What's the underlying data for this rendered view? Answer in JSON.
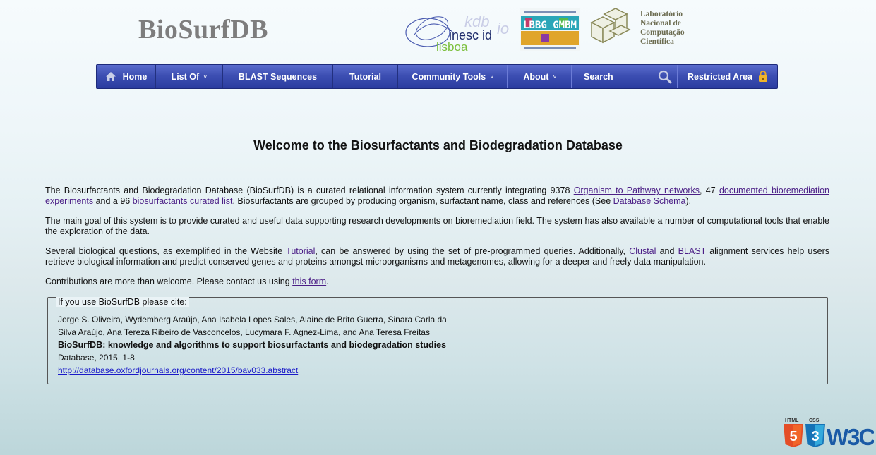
{
  "header": {
    "site_title": "BioSurfDB",
    "partners": {
      "inesc": {
        "line1": "kdb",
        "line2": "inesc id",
        "line3": "lisboa",
        "bio": "io"
      },
      "bbg": {
        "text": "LBBG GMBM"
      },
      "lncc": {
        "lines": [
          "Laboratório",
          "Nacional de",
          "Computação",
          "Científica"
        ]
      }
    }
  },
  "nav": {
    "home": "Home",
    "list_of": "List Of",
    "blast": "BLAST Sequences",
    "tutorial": "Tutorial",
    "community_tools": "Community Tools",
    "about": "About",
    "search": "Search",
    "restricted": "Restricted Area",
    "chevron": "˅"
  },
  "main": {
    "title": "Welcome to the Biosurfactants and Biodegradation Database",
    "p1": {
      "text1": "The Biosurfactants and Biodegradation Database (BioSurfDB) is a curated relational information system currently integrating 9378 ",
      "link1": "Organism to Pathway networks",
      "text2": ", 47 ",
      "link2": "documented bioremediation experiments",
      "text3": " and a 96 ",
      "link3": "biosurfactants curated list",
      "text4": ". Biosurfactants are grouped by producing organism, surfactant name, class and references (See ",
      "link4": "Database Schema",
      "text5": ")."
    },
    "p2": "The main goal of this system is to provide curated and useful data supporting research developments on bioremediation field. The system has also available a number of computational tools that enable the exploration of the data.",
    "p3": {
      "text1": "Several biological questions, as exemplified in the Website ",
      "link1": "Tutorial",
      "text2": ", can be answered by using the set of pre-programmed queries. Additionally, ",
      "link2": "Clustal",
      "text3": " and ",
      "link3": "BLAST",
      "text4": " alignment services help users retrieve biological information and predict conserved genes and proteins amongst microorganisms and metagenomes, allowing for a deeper and freely data manipulation."
    },
    "p4": {
      "text1": "Contributions are more than welcome. Please contact us using ",
      "link1": "this form",
      "text2": "."
    }
  },
  "citation": {
    "legend": "If you use BioSurfDB please cite:",
    "authors_line1": "Jorge S. Oliveira, Wydemberg Araújo, Ana Isabela Lopes Sales, Alaine de Brito Guerra, Sinara Carla da",
    "authors_line2": "Silva Araújo, Ana Tereza Ribeiro de Vasconcelos, Lucymara F. Agnez-Lima, and Ana Teresa Freitas",
    "title": "BioSurfDB: knowledge and algorithms to support biosurfactants and biodegradation studies",
    "journal": "Database, 2015, 1-8",
    "url": "http://database.oxfordjournals.org/content/2015/bav033.abstract"
  },
  "footer": {
    "badge_html": "HTML",
    "badge_css": "CSS",
    "badge_w3c": "W3C",
    "badge_5": "5",
    "badge_3": "3"
  },
  "colors": {
    "nav_bg": "#3d4fb3",
    "link": "#4b1e86",
    "logo_gray": "#7d7d7d"
  }
}
